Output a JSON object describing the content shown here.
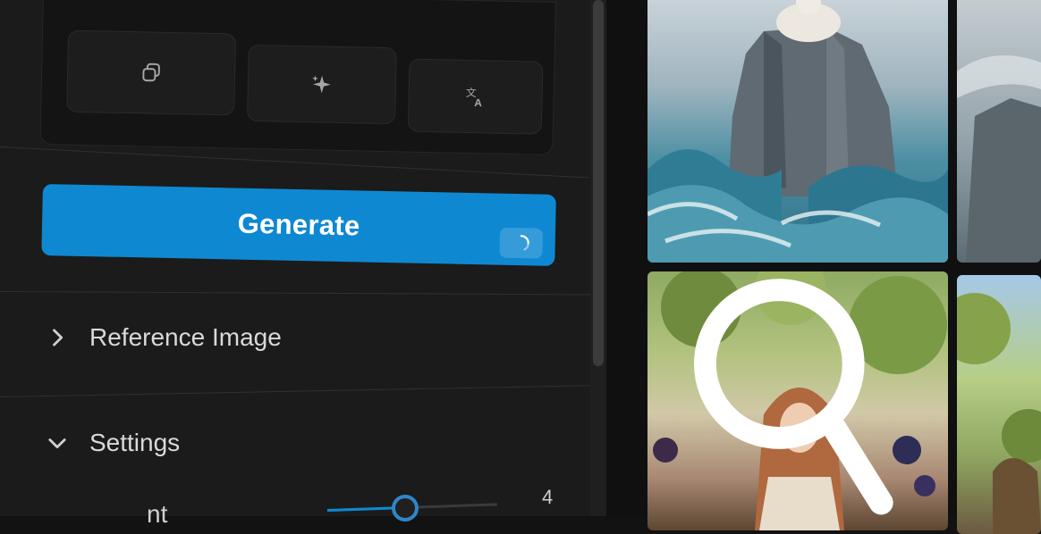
{
  "sidebar": {
    "tools": [
      {
        "icon": "copy-icon"
      },
      {
        "icon": "sparkle-icon"
      },
      {
        "icon": "translate-icon"
      }
    ],
    "generate": {
      "label": "Generate",
      "status_icon": "spinner-icon",
      "color": "#0f88d2"
    },
    "sections": [
      {
        "label": "Reference Image",
        "expanded": false,
        "icon": "chevron-right-icon"
      },
      {
        "label": "Settings",
        "expanded": true,
        "icon": "chevron-down-icon"
      }
    ],
    "slider": {
      "label_partial": "nt",
      "value": "4"
    }
  },
  "gallery": {
    "tiles": [
      {
        "name": "rock-in-waves"
      },
      {
        "name": "rock-partial"
      },
      {
        "name": "woman-in-vineyard"
      },
      {
        "name": "vineyard-partial"
      }
    ],
    "search_icon": "search-icon"
  }
}
